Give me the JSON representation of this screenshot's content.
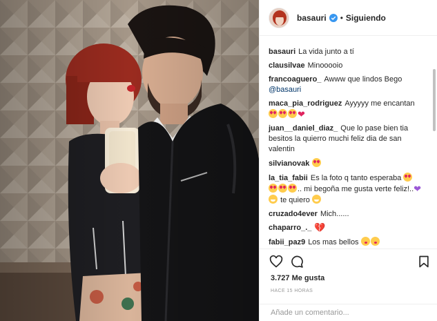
{
  "post": {
    "username": "basauri",
    "separator": "•",
    "follow_label": "Siguiendo",
    "caption": "La vida junto a tí",
    "likes": "3.727 Me gusta",
    "time_ago": "HACE 15 HORAS",
    "comment_placeholder": "Añade un comentario..."
  },
  "comments": [
    {
      "author": "clausilvae",
      "text": "Minooooio"
    },
    {
      "author": "francoaguero_",
      "text": "Awww que lindos Bego",
      "mention": "@basauri"
    },
    {
      "author": "maca_pia_rodriguez",
      "text": "Ayyyyy me encantan"
    },
    {
      "author": "juan__daniel_diaz_",
      "text": "Que lo pase bien tia besitos la quierro muchi feliz dia de san valentin"
    },
    {
      "author": "silvianovak",
      "text": ""
    },
    {
      "author": "la_tia_fabii",
      "text": "Es la foto q tanto esperaba",
      "text2": ".. mi begoña me gusta verte feliz!..",
      "text3": "te quiero"
    },
    {
      "author": "cruzado4ever",
      "text": "Mich......"
    },
    {
      "author": "chaparro_._",
      "text": ""
    },
    {
      "author": "fabii_paz9",
      "text": "Los mas bellos"
    }
  ],
  "icons": {
    "like": "heart-outline-icon",
    "comment": "speech-bubble-icon",
    "save": "bookmark-icon",
    "verified": "verified-badge-icon"
  },
  "colors": {
    "verified": "#3897f0",
    "text": "#262626",
    "muted": "#999999",
    "border": "#efefef",
    "mention": "#003569"
  }
}
